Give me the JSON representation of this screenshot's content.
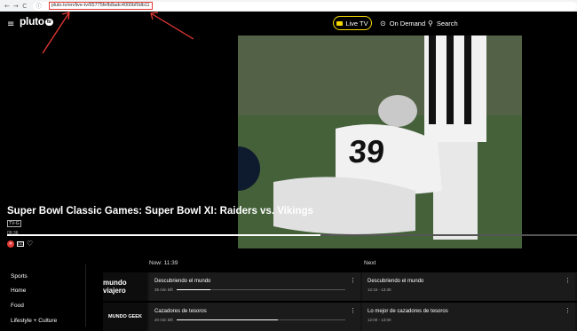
{
  "browser": {
    "back": "←",
    "forward": "→",
    "reload": "C",
    "url": "pluto.tv/en/live-tv/65775fefb8adc4000bf0db11"
  },
  "header": {
    "logo": "pluto",
    "logo_badge": "tv",
    "live_tv": "Live TV",
    "on_demand": "On Demand",
    "search": "Search"
  },
  "player": {
    "title": "Super Bowl Classic Games: Super Bowl XI: Raiders vs. Vikings",
    "rating": "TV-G",
    "time": "09:36",
    "progress": 0.55,
    "jersey": "39"
  },
  "sidebar": {
    "items": [
      {
        "label": "Sports"
      },
      {
        "label": "Home"
      },
      {
        "label": "Food"
      },
      {
        "label": "Lifestyle + Culture"
      }
    ]
  },
  "guide": {
    "now_label": "Now: 11:39",
    "next_label": "Next",
    "rows": [
      {
        "channel": "mundo viajero",
        "now_title": "Descubriendo el mundo",
        "now_left": "35 min left",
        "now_progress": 0.2,
        "next_title": "Descubriendo el mundo",
        "next_time": "12:15 - 13:30"
      },
      {
        "channel": "MUNDO GEEK",
        "now_title": "Cazadores de tesoros",
        "now_left": "20 min left",
        "now_progress": 0.6,
        "next_title": "Lo mejor de cazadores de tesoros",
        "next_time": "12:00 - 13:00"
      }
    ]
  },
  "colors": {
    "accent": "#f5d700",
    "annotation": "#e53935"
  }
}
